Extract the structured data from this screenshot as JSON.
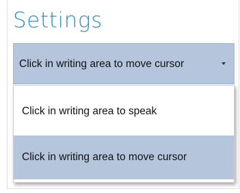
{
  "header": {
    "title": "Settings"
  },
  "select": {
    "value": "Click in writing area to move cursor",
    "arrow_icon": "chevron-down-icon"
  },
  "dropdown": {
    "options": [
      {
        "label": "Click in writing area to speak",
        "selected": false
      },
      {
        "label": "Click in writing area to move cursor",
        "selected": true
      }
    ]
  },
  "colors": {
    "title": "#2d8fc9",
    "selection": "#b4c5dc",
    "text": "#111111"
  }
}
